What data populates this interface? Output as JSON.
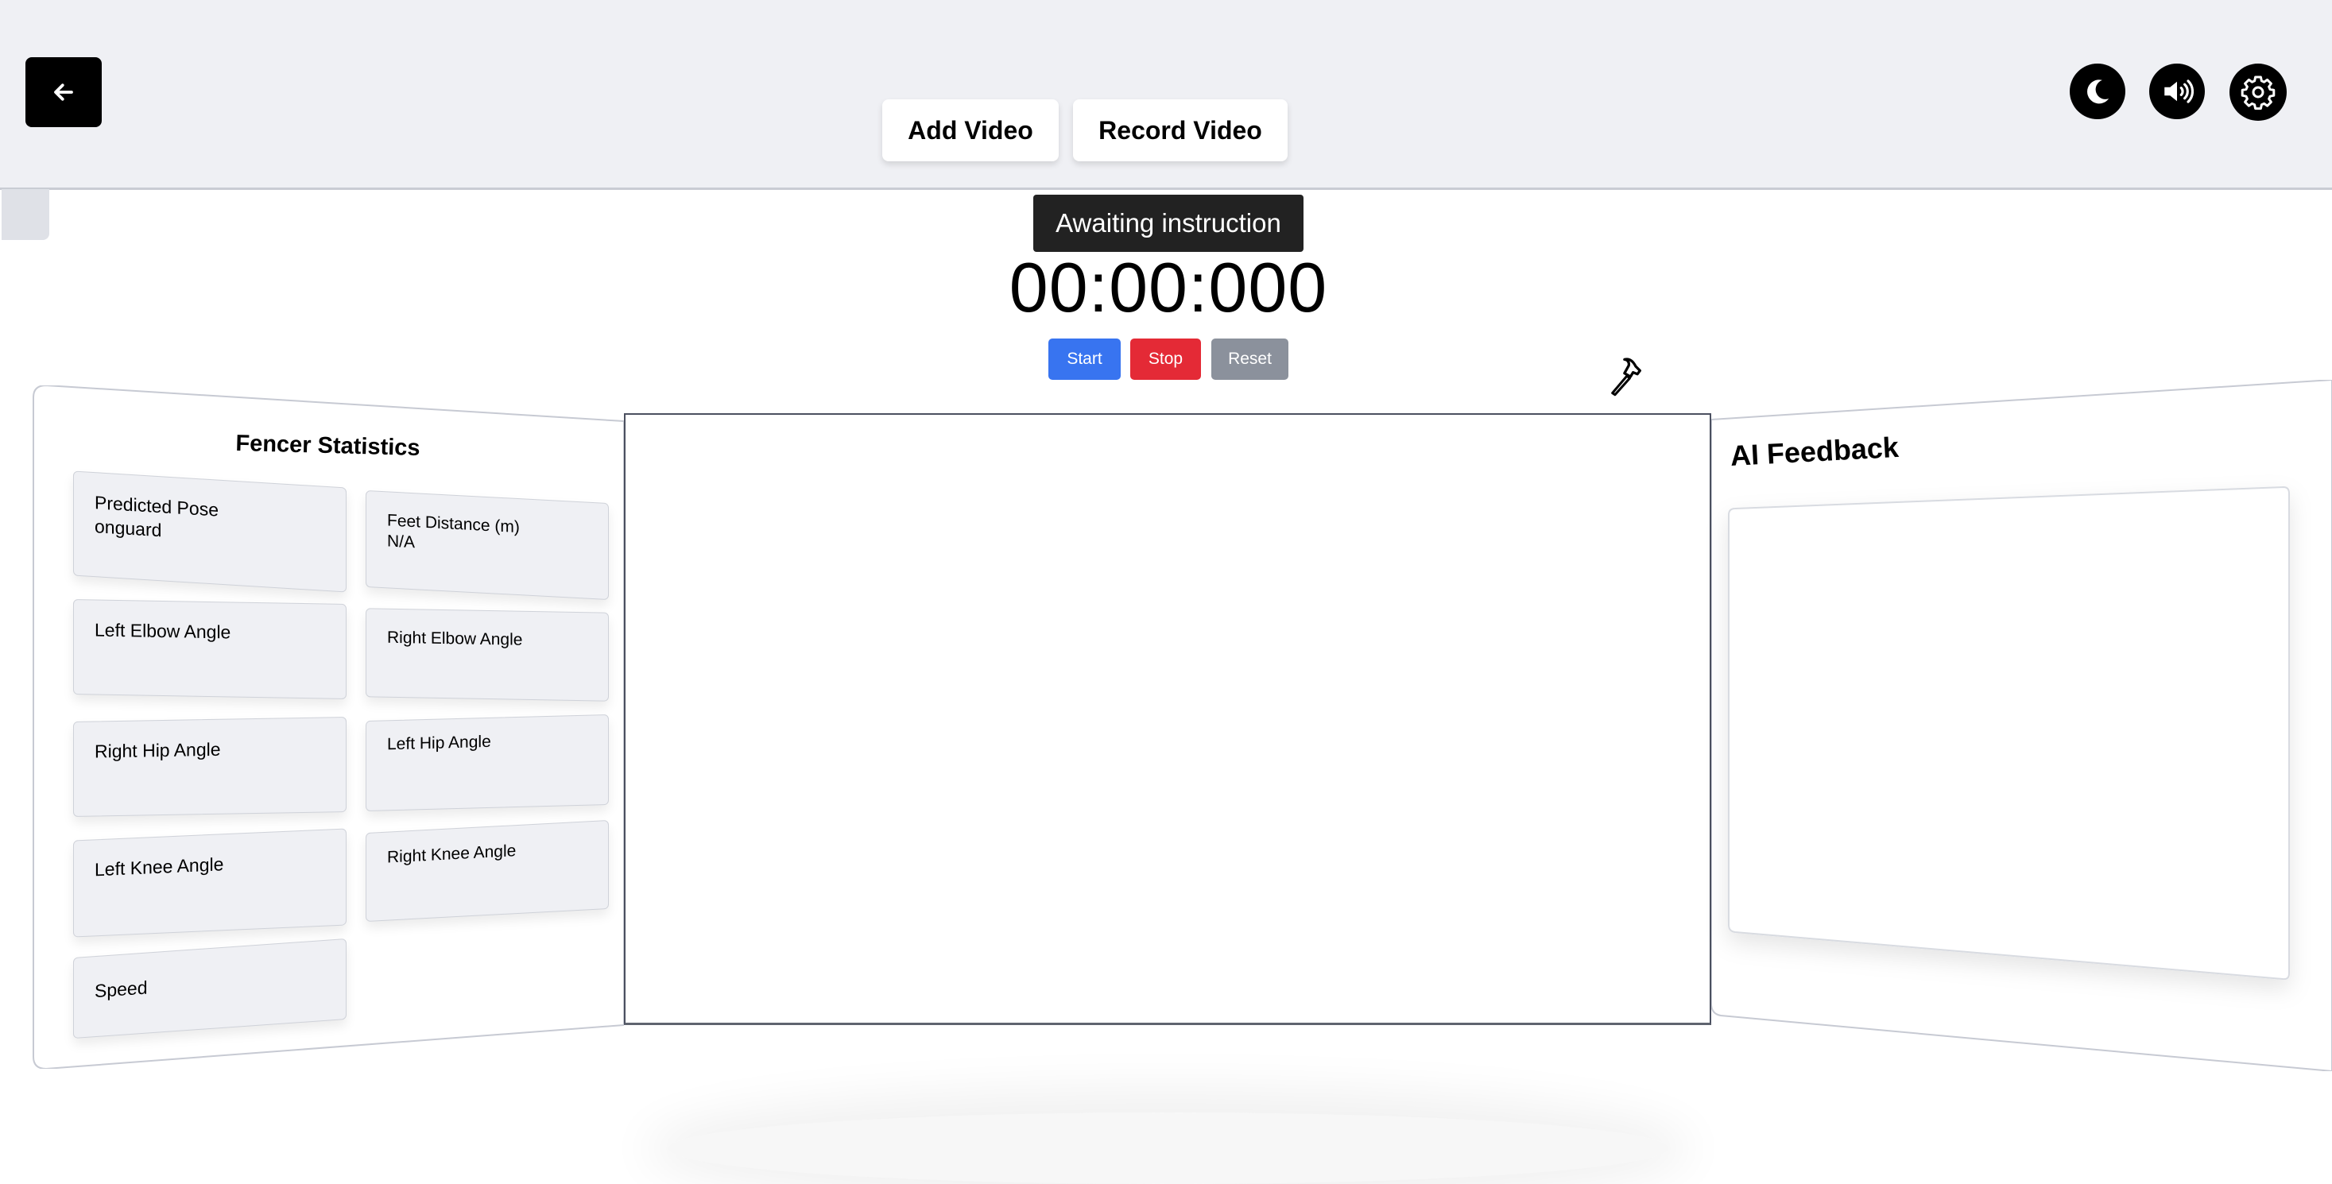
{
  "header": {
    "back_icon": "arrow-left-icon",
    "add_video_label": "Add Video",
    "record_video_label": "Record Video",
    "icons": [
      "moon-icon",
      "speaker-volume-icon",
      "gear-icon"
    ]
  },
  "status": {
    "message": "Awaiting instruction",
    "timer": "00:00:000"
  },
  "controls": {
    "start_label": "Start",
    "stop_label": "Stop",
    "reset_label": "Reset",
    "colors": {
      "start": "#3874f0",
      "stop": "#e42a36",
      "reset": "#8b919c"
    }
  },
  "tool_icon": "hammer-icon",
  "stats": {
    "title": "Fencer Statistics",
    "cards": [
      {
        "label": "Predicted Pose",
        "value": "onguard"
      },
      {
        "label": "Feet Distance (m)",
        "value": "N/A"
      },
      {
        "label": "Left Elbow Angle",
        "value": ""
      },
      {
        "label": "Right Elbow Angle",
        "value": ""
      },
      {
        "label": "Right Hip Angle",
        "value": ""
      },
      {
        "label": "Left Hip Angle",
        "value": ""
      },
      {
        "label": "Left Knee Angle",
        "value": ""
      },
      {
        "label": "Right Knee Angle",
        "value": ""
      },
      {
        "label": "Speed",
        "value": ""
      }
    ]
  },
  "feedback": {
    "title": "AI Feedback",
    "content": ""
  }
}
